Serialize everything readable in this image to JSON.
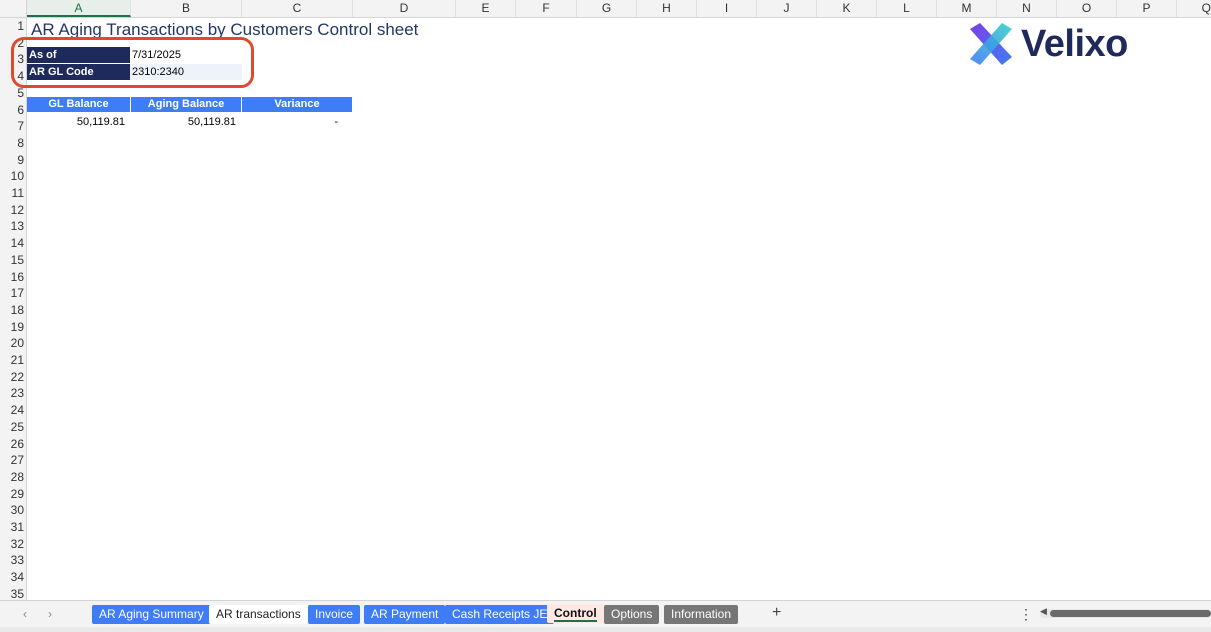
{
  "sheet": {
    "title": "AR Aging Transactions by Customers Control sheet",
    "columns": [
      "A",
      "B",
      "C",
      "D",
      "E",
      "F",
      "G",
      "H",
      "I",
      "J",
      "K",
      "L",
      "M",
      "N",
      "O",
      "P",
      "Q"
    ],
    "rows": [
      "1",
      "2",
      "3",
      "4",
      "5",
      "6",
      "7",
      "8",
      "9",
      "10",
      "11",
      "12",
      "13",
      "14",
      "15",
      "16",
      "17",
      "18",
      "19",
      "20",
      "21",
      "22",
      "23",
      "24",
      "25",
      "26",
      "27",
      "28",
      "29",
      "30",
      "31",
      "32",
      "33",
      "34",
      "35"
    ],
    "params": {
      "as_of_label": "As of",
      "as_of_value": "7/31/2025",
      "gl_code_label": "AR GL Code",
      "gl_code_value": "2310:2340"
    },
    "table": {
      "headers": [
        "GL Balance",
        "Aging Balance",
        "Variance"
      ],
      "row": [
        "50,119.81",
        "50,119.81",
        "-"
      ]
    }
  },
  "logo": {
    "text": "Velixo"
  },
  "tabs": [
    {
      "label": "AR Aging Summary",
      "style": "blue"
    },
    {
      "label": "AR transactions",
      "style": "white"
    },
    {
      "label": "Invoice",
      "style": "blue"
    },
    {
      "label": "AR Payment",
      "style": "blue"
    },
    {
      "label": "Cash Receipts JE",
      "style": "blue"
    },
    {
      "label": "Control",
      "style": "active"
    },
    {
      "label": "Options",
      "style": "gray"
    },
    {
      "label": "Information",
      "style": "gray"
    }
  ],
  "controls": {
    "prev_icon": "‹",
    "next_icon": "›",
    "add_sheet": "+",
    "more": "⋮"
  },
  "colors": {
    "header_blue": "#3f7cf7",
    "label_navy": "#1f2a5c",
    "highlight_red": "#e0492f",
    "active_col_green": "#1e7145"
  }
}
